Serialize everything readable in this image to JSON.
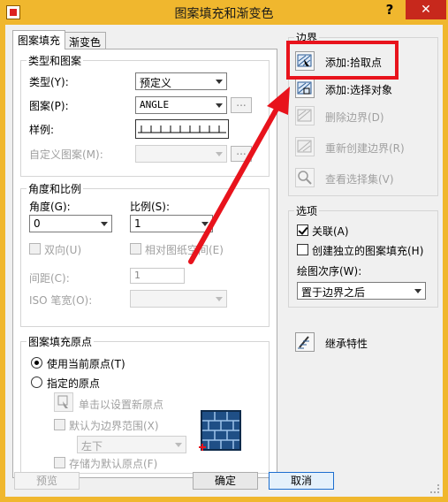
{
  "window": {
    "title": "图案填充和渐变色",
    "help_glyph": "?",
    "close_glyph": "✕"
  },
  "tabs": [
    {
      "label": "图案填充",
      "active": true
    },
    {
      "label": "渐变色",
      "active": false
    }
  ],
  "type_pattern": {
    "group_title": "类型和图案",
    "type_label": "类型(Y):",
    "type_value": "预定义",
    "pattern_label": "图案(P):",
    "pattern_value": "ANGLE",
    "pattern_browse": "...",
    "sample_label": "样例:",
    "custom_label": "自定义图案(M):",
    "custom_value": "",
    "custom_browse": "..."
  },
  "angle_scale": {
    "group_title": "角度和比例",
    "angle_label": "角度(G):",
    "angle_value": "0",
    "scale_label": "比例(S):",
    "scale_value": "1",
    "double_label": "双向(U)",
    "relative_label": "相对图纸空间(E)",
    "spacing_label": "间距(C):",
    "spacing_value": "1",
    "iso_label": "ISO 笔宽(O):",
    "iso_value": ""
  },
  "origin": {
    "group_title": "图案填充原点",
    "use_current_label": "使用当前原点(T)",
    "specified_label": "指定的原点",
    "click_set_label": "单击以设置新原点",
    "default_extents_label": "默认为边界范围(X)",
    "extents_value": "左下",
    "store_default_label": "存储为默认原点(F)"
  },
  "boundaries": {
    "group_title": "边界",
    "add_pick_points": "添加:拾取点",
    "add_select_objects": "添加:选择对象",
    "remove_boundaries": "删除边界(D)",
    "recreate_boundary": "重新创建边界(R)",
    "view_selections": "查看选择集(V)"
  },
  "options": {
    "group_title": "选项",
    "associative_label": "关联(A)",
    "separate_label": "创建独立的图案填充(H)",
    "draw_order_label": "绘图次序(W):",
    "draw_order_value": "置于边界之后"
  },
  "inherit_label": "继承特性",
  "footer": {
    "preview": "预览",
    "ok": "确定",
    "cancel": "取消"
  },
  "colors": {
    "title_bar": "#f0b72e",
    "close_button": "#c7281c",
    "annotation_red": "#e8131c",
    "preview_blue": "#1f4f86"
  },
  "icons": [
    "app-icon",
    "pick-points-icon",
    "select-objects-icon",
    "remove-boundaries-icon",
    "recreate-boundary-icon",
    "view-selections-icon",
    "inherit-properties-icon",
    "set-origin-icon",
    "origin-preview-icon"
  ]
}
